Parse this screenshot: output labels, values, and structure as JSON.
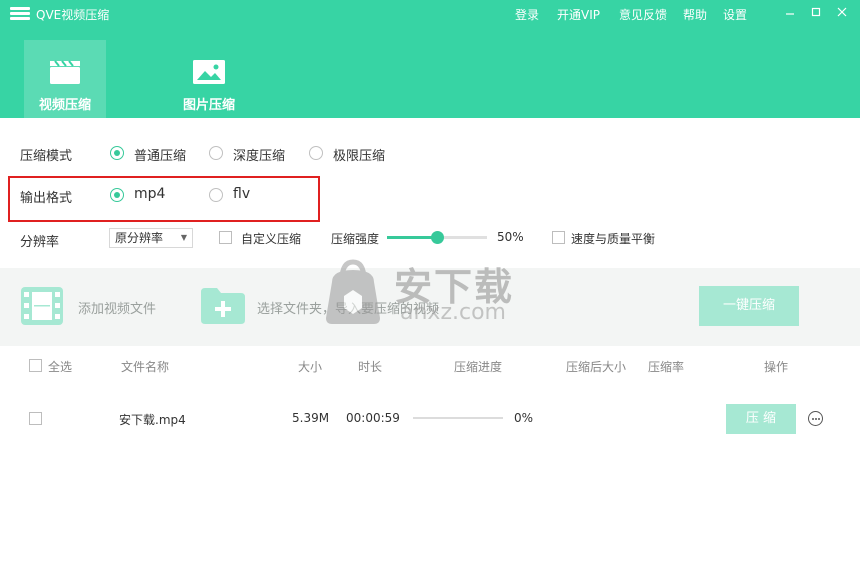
{
  "colors": {
    "brand": "#37d4a4",
    "accent": "#37c99a",
    "button_light": "#a6e8d3",
    "highlight": "#e02020"
  },
  "header": {
    "app_title": "QVE视频压缩",
    "nav": [
      "登录",
      "开通VIP",
      "意见反馈",
      "帮助",
      "设置"
    ],
    "window_controls": [
      "minimize-icon",
      "restore-icon",
      "close-icon"
    ],
    "tabs": [
      {
        "label": "视频压缩",
        "icon": "film-clapper-icon",
        "active": true
      },
      {
        "label": "图片压缩",
        "icon": "image-icon",
        "active": false
      }
    ]
  },
  "options": {
    "mode_label": "压缩模式",
    "modes": [
      {
        "label": "普通压缩",
        "checked": true
      },
      {
        "label": "深度压缩",
        "checked": false
      },
      {
        "label": "极限压缩",
        "checked": false
      }
    ],
    "format_label": "输出格式",
    "formats": [
      {
        "label": "mp4",
        "checked": true
      },
      {
        "label": "flv",
        "checked": false
      }
    ],
    "resolution_label": "分辨率",
    "resolution_value": "原分辨率",
    "custom_label": "自定义压缩",
    "strength_label": "压缩强度",
    "strength_value": "50%",
    "strength_fraction": 0.5,
    "balance_label": "速度与质量平衡"
  },
  "toolbar": {
    "add_video_label": "添加视频文件",
    "select_folder_label": "选择文件夹，导入要压缩的视频",
    "one_key_label": "一键压缩"
  },
  "watermark": {
    "text": "安下载",
    "sub": "anxz.com"
  },
  "table": {
    "headers": {
      "select_all": "全选",
      "name": "文件名称",
      "size": "大小",
      "duration": "时长",
      "progress": "压缩进度",
      "size_after": "压缩后大小",
      "ratio": "压缩率",
      "actions": "操作"
    },
    "rows": [
      {
        "name": "安下载.mp4",
        "size": "5.39M",
        "duration": "00:00:59",
        "progress": "0%",
        "progress_fraction": 0,
        "action_label": "压 缩"
      }
    ]
  }
}
